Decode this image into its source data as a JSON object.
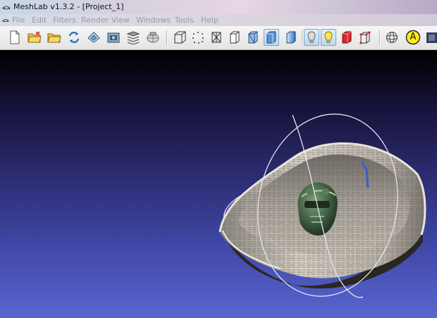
{
  "window": {
    "title": "MeshLab v1.3.2 - [Project_1]"
  },
  "menu": {
    "items": [
      "File",
      "Edit",
      "Filters",
      "Render",
      "View",
      "Windows",
      "Tools",
      "Help"
    ]
  },
  "toolbar": {
    "buttons": [
      {
        "icon": "new-document-icon"
      },
      {
        "icon": "open-project-icon"
      },
      {
        "icon": "import-mesh-icon"
      },
      {
        "icon": "reload-icon"
      },
      {
        "icon": "export-mesh-icon"
      },
      {
        "icon": "snapshot-icon"
      },
      {
        "icon": "layers-icon"
      },
      {
        "icon": "raster-icon"
      },
      {
        "icon": "bounding-box-icon"
      },
      {
        "icon": "points-icon"
      },
      {
        "icon": "wireframe-icon"
      },
      {
        "icon": "hidden-lines-icon"
      },
      {
        "icon": "flat-lines-icon"
      },
      {
        "icon": "flat-icon"
      },
      {
        "icon": "smooth-icon"
      },
      {
        "icon": "light-icon"
      },
      {
        "icon": "double-side-lighting-icon"
      },
      {
        "icon": "backface-culling-icon"
      },
      {
        "icon": "trackball-icon"
      },
      {
        "icon": "selection-annotation-icon"
      },
      {
        "icon": "show-rasters-icon"
      }
    ],
    "annotation_label": "A"
  },
  "colors": {
    "viewport_top": "#000000",
    "viewport_bottom": "#5866d0",
    "trackball": "#e8e8f4",
    "bowl_rim": "#cfc9c0",
    "bowl_inner": "#a9a39a",
    "figure": "#4c6d4c"
  }
}
